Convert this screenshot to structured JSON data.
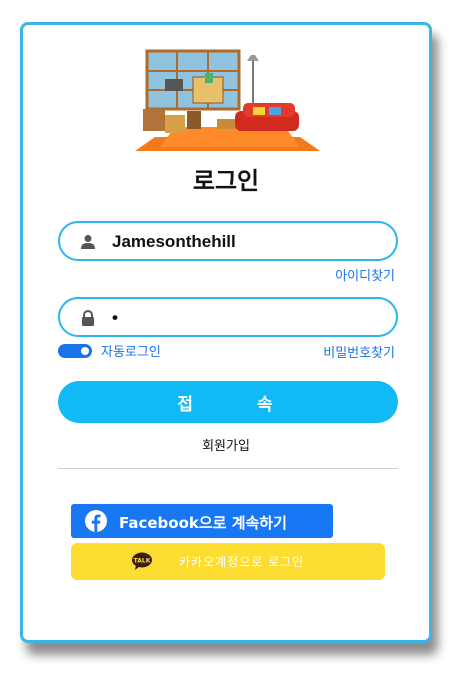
{
  "page": {
    "title": "로그인"
  },
  "form": {
    "username_value": "Jamesonthehill",
    "password_value": "•",
    "find_id_label": "아이디찾기",
    "find_password_label": "비밀번호찾기",
    "auto_login_label": "자동로그인",
    "auto_login_on": true,
    "submit_label": "접속",
    "signup_label": "회원가입"
  },
  "social": {
    "facebook_label": "Facebook으로 계속하기",
    "kakao_label": "카카오계정으로 로그인",
    "kakao_badge": "TALK"
  },
  "colors": {
    "accent": "#12baf5",
    "link": "#1a73e8",
    "facebook": "#1877f2",
    "kakao": "#fedd33",
    "card_border": "#3bb4e6"
  },
  "icons": {
    "illustration": "living-room-illustration",
    "username": "user-icon",
    "password": "lock-icon",
    "facebook": "facebook-icon",
    "kakao": "kakao-talk-icon"
  }
}
